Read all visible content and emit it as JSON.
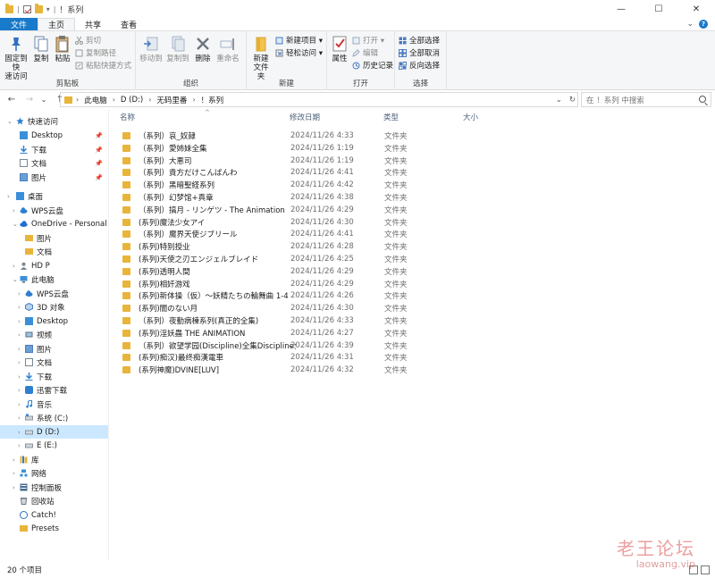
{
  "window": {
    "title": "！系列",
    "qa_sep": "|",
    "qa_dropdown": "▾",
    "min_glyph": "—",
    "max_glyph": "☐",
    "close_glyph": "✕"
  },
  "ribbon_tabs": {
    "file": "文件",
    "home": "主页",
    "share": "共享",
    "view": "查看",
    "collapse_glyph": "⌄",
    "help_glyph": "?"
  },
  "ribbon": {
    "clipboard": {
      "name": "剪贴板",
      "pin": "固定到快\n速访问",
      "copy": "复制",
      "paste": "粘贴",
      "cut": "剪切",
      "copy_path": "复制路径",
      "paste_shortcut": "粘贴快捷方式"
    },
    "organize": {
      "name": "组织",
      "move_to": "移动到",
      "copy_to": "复制到",
      "delete": "删除",
      "rename": "重命名"
    },
    "new": {
      "name": "新建",
      "new_folder": "新建\n文件夹",
      "new_item": "新建项目 ▾",
      "easy_access": "轻松访问 ▾"
    },
    "open": {
      "name": "打开",
      "properties": "属性",
      "open": "打开 ▾",
      "edit": "编辑",
      "history": "历史记录"
    },
    "select": {
      "name": "选择",
      "select_all": "全部选择",
      "select_none": "全部取消",
      "invert": "反向选择"
    }
  },
  "nav": {
    "back_glyph": "←",
    "forward_glyph": "→",
    "recent_glyph": "⌄",
    "up_glyph": "↑",
    "breadcrumbs": [
      "此电脑",
      "D (D:)",
      "无码里番",
      "！系列"
    ],
    "crumb_sep": "›",
    "address_dropdown": "⌄",
    "refresh_glyph": "↻",
    "search_placeholder": "在 ！系列 中搜索"
  },
  "sidebar": {
    "expand_glyph": "›",
    "open_glyph": "⌄",
    "pin_glyph": "📌",
    "items": [
      {
        "label": "快速访问"
      },
      {
        "label": "Desktop"
      },
      {
        "label": "下载"
      },
      {
        "label": "文档"
      },
      {
        "label": "图片"
      },
      {
        "label": "桌面"
      },
      {
        "label": "WPS云盘"
      },
      {
        "label": "OneDrive - Personal"
      },
      {
        "label": "图片"
      },
      {
        "label": "文档"
      },
      {
        "label": "HD P"
      },
      {
        "label": "此电脑"
      },
      {
        "label": "WPS云盘"
      },
      {
        "label": "3D 对象"
      },
      {
        "label": "Desktop"
      },
      {
        "label": "视频"
      },
      {
        "label": "图片"
      },
      {
        "label": "文档"
      },
      {
        "label": "下载"
      },
      {
        "label": "迅雷下载"
      },
      {
        "label": "音乐"
      },
      {
        "label": "系统 (C:)"
      },
      {
        "label": "D (D:)"
      },
      {
        "label": "E (E:)"
      },
      {
        "label": "库"
      },
      {
        "label": "网络"
      },
      {
        "label": "控制面板"
      },
      {
        "label": "回收站"
      },
      {
        "label": "Catch!"
      },
      {
        "label": "Presets"
      }
    ]
  },
  "columns": {
    "name": "名称",
    "date": "修改日期",
    "type": "类型",
    "size": "大小",
    "sort_glyph": "^"
  },
  "files": [
    {
      "name": "（系列）哀_奴隷",
      "date": "2024/11/26 4:33",
      "type": "文件夹"
    },
    {
      "name": "（系列）愛姉妹全集",
      "date": "2024/11/26 1:19",
      "type": "文件夹"
    },
    {
      "name": "（系列）大悪司",
      "date": "2024/11/26 1:19",
      "type": "文件夹"
    },
    {
      "name": "（系列）貴方だけこんばんわ",
      "date": "2024/11/26 4:41",
      "type": "文件夹"
    },
    {
      "name": "（系列）黑暗聖経系列",
      "date": "2024/11/26 4:42",
      "type": "文件夹"
    },
    {
      "name": "（系列）幻梦馆+真章",
      "date": "2024/11/26 4:38",
      "type": "文件夹"
    },
    {
      "name": "（系列）搞月 - リンゲツ - The Animation",
      "date": "2024/11/26 4:29",
      "type": "文件夹"
    },
    {
      "name": "(系列)魔法少女アイ",
      "date": "2024/11/26 4:30",
      "type": "文件夹"
    },
    {
      "name": "（系列）魔界天使ジブリール",
      "date": "2024/11/26 4:41",
      "type": "文件夹"
    },
    {
      "name": "(系列)特别授业",
      "date": "2024/11/26 4:28",
      "type": "文件夹"
    },
    {
      "name": "(系列)天使之刃エンジェルブレイド",
      "date": "2024/11/26 4:25",
      "type": "文件夹"
    },
    {
      "name": "(系列)透明人間",
      "date": "2024/11/26 4:29",
      "type": "文件夹"
    },
    {
      "name": "(系列)相奸游戏",
      "date": "2024/11/26 4:29",
      "type": "文件夹"
    },
    {
      "name": "(系列)新体操（仮）～妖精たちの輪舞曲 1-4",
      "date": "2024/11/26 4:26",
      "type": "文件夹"
    },
    {
      "name": "(系列)闇のない月",
      "date": "2024/11/26 4:30",
      "type": "文件夹"
    },
    {
      "name": "（系列）夜勤病棟系列(真正的全集)",
      "date": "2024/11/26 4:33",
      "type": "文件夹"
    },
    {
      "name": "(系列)淫妖蟲 THE ANIMATION",
      "date": "2024/11/26 4:27",
      "type": "文件夹"
    },
    {
      "name": "（系列）欲望学园(Discipline)全集Discipline全",
      "date": "2024/11/26 4:39",
      "type": "文件夹"
    },
    {
      "name": "(系列)痴汉)最终痴漢電車",
      "date": "2024/11/26 4:31",
      "type": "文件夹"
    },
    {
      "name": "(系列神魔)DVINE[LUV]",
      "date": "2024/11/26 4:32",
      "type": "文件夹"
    }
  ],
  "status": {
    "count": "20 个项目"
  },
  "watermark": {
    "line1": "老王论坛",
    "line2": "laowang.vip"
  },
  "colors": {
    "folder": "#e8b43a",
    "accent": "#1979ca",
    "selection": "#cce8ff"
  }
}
